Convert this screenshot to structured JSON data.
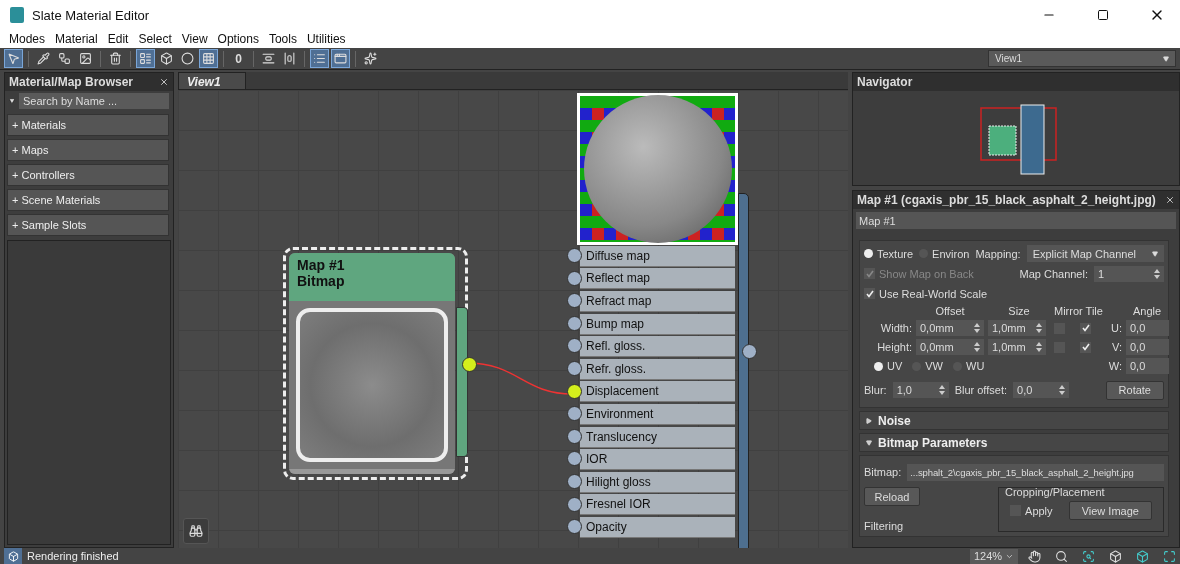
{
  "window": {
    "title": "Slate Material Editor"
  },
  "menu": [
    "Modes",
    "Material",
    "Edit",
    "Select",
    "View",
    "Options",
    "Tools",
    "Utilities"
  ],
  "toolbar": {
    "buttons": [
      {
        "selected": true
      },
      {
        "selected": false
      },
      {
        "selected": false
      },
      {
        "selected": false
      },
      {
        "selected": false
      },
      {
        "selected": true
      },
      {
        "selected": false
      },
      {
        "selected": false
      },
      {
        "selected": true
      },
      {
        "selected": false,
        "label": "0"
      },
      {
        "selected": false
      },
      {
        "selected": false
      },
      {
        "selected": true
      },
      {
        "selected": true
      },
      {
        "selected": false
      }
    ],
    "view_selector": "View1"
  },
  "browser": {
    "title": "Material/Map Browser",
    "search": {
      "placeholder": "Search by Name ..."
    },
    "groups": [
      "+ Materials",
      "+ Maps",
      "+ Controllers",
      "+ Scene Materials",
      "+ Sample Slots"
    ]
  },
  "view": {
    "tab": "View1",
    "map_node": {
      "title": "Map #1",
      "subtitle": "Bitmap",
      "selected": true
    },
    "material_node": {
      "slots": [
        {
          "label": "Diffuse map",
          "connected": false
        },
        {
          "label": "Reflect map",
          "connected": false
        },
        {
          "label": "Refract map",
          "connected": false
        },
        {
          "label": "Bump map",
          "connected": false
        },
        {
          "label": "Refl. gloss.",
          "connected": false
        },
        {
          "label": "Refr. gloss.",
          "connected": false
        },
        {
          "label": "Displacement",
          "connected": true
        },
        {
          "label": "Environment",
          "connected": false
        },
        {
          "label": "Translucency",
          "connected": false
        },
        {
          "label": "IOR",
          "connected": false
        },
        {
          "label": "Hilight gloss",
          "connected": false
        },
        {
          "label": "Fresnel IOR",
          "connected": false
        },
        {
          "label": "Opacity",
          "connected": false
        }
      ]
    }
  },
  "navigator": {
    "title": "Navigator"
  },
  "params": {
    "title": "Map #1 (cgaxis_pbr_15_black_asphalt_2_height.jpg)",
    "name": "Map #1",
    "coordinates": {
      "mapping_type": [
        {
          "label": "Texture",
          "selected": true
        },
        {
          "label": "Environ",
          "selected": false
        }
      ],
      "mapping_label": "Mapping:",
      "mapping_value": "Explicit Map Channel",
      "show_map_on_back": {
        "label": "Show Map on Back",
        "checked": true,
        "disabled": true
      },
      "map_channel": {
        "label": "Map Channel:",
        "value": "1"
      },
      "real_world": {
        "label": "Use Real-World Scale",
        "checked": true,
        "disabled": false
      },
      "headers": [
        "Offset",
        "Size",
        "Mirror Tile",
        "Angle"
      ],
      "rows": [
        {
          "label": "Width:",
          "offset": "0,0mm",
          "size": "1,0mm",
          "mirror": false,
          "tile": true,
          "axis": "U:",
          "angle": "0,0"
        },
        {
          "label": "Height:",
          "offset": "0,0mm",
          "size": "1,0mm",
          "mirror": false,
          "tile": true,
          "axis": "V:",
          "angle": "0,0"
        }
      ],
      "w_angle": {
        "label": "W:",
        "value": "0,0"
      },
      "uvw": [
        {
          "label": "UV",
          "selected": true
        },
        {
          "label": "VW",
          "selected": false
        },
        {
          "label": "WU",
          "selected": false
        }
      ],
      "blur": {
        "label": "Blur:",
        "value": "1,0"
      },
      "blur_offset": {
        "label": "Blur offset:",
        "value": "0,0"
      },
      "rotate": "Rotate"
    },
    "rollouts": [
      {
        "title": "Noise",
        "expanded": false
      },
      {
        "title": "Bitmap Parameters",
        "expanded": true
      }
    ],
    "bitmap": {
      "label": "Bitmap:",
      "path": "...sphalt_2\\cgaxis_pbr_15_black_asphalt_2_height.jpg",
      "reload": "Reload",
      "cropping": "Cropping/Placement",
      "apply": {
        "label": "Apply",
        "checked": false
      },
      "view_image": "View Image",
      "filtering": "Filtering"
    }
  },
  "status_bar": {
    "message": "Rendering finished",
    "zoom": "124%"
  }
}
